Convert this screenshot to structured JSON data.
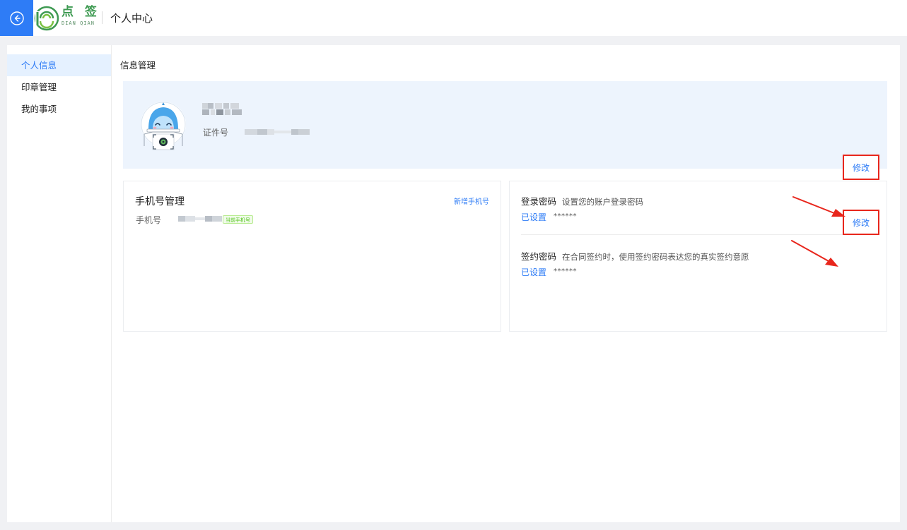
{
  "header": {
    "logo_cn": "点 签",
    "logo_en": "DIAN QIAN",
    "title": "个人中心"
  },
  "sidebar": {
    "items": [
      {
        "label": "个人信息",
        "active": true
      },
      {
        "label": "印章管理",
        "active": false
      },
      {
        "label": "我的事项",
        "active": false
      }
    ]
  },
  "main": {
    "section_title": "信息管理",
    "profile": {
      "id_label": "证件号"
    },
    "phone": {
      "title": "手机号管理",
      "add_label": "新增手机号",
      "phone_label": "手机号",
      "current_badge": "当前手机号"
    },
    "passwords": [
      {
        "name": "登录密码",
        "desc": "设置您的账户登录密码",
        "state": "已设置",
        "mask": "******",
        "action": "修改"
      },
      {
        "name": "签约密码",
        "desc": "在合同签约时，使用签约密码表达您的真实签约意愿",
        "state": "已设置",
        "mask": "******",
        "action": "修改"
      }
    ]
  },
  "colors": {
    "accent": "#2e7cf6",
    "highlight": "#e8261c",
    "brand_green": "#3e9a52",
    "profile_bg": "#edf4fd"
  }
}
